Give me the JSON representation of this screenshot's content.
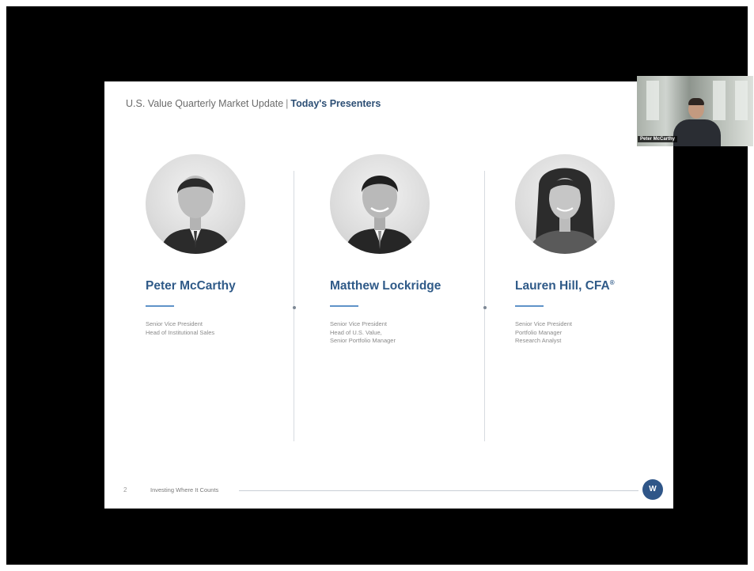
{
  "slide": {
    "title_prefix": "U.S. Value Quarterly Market Update",
    "title_separator": "|",
    "title_highlight": "Today's Presenters",
    "page_number": "2",
    "footer_text": "Investing Where It Counts",
    "logo_text": "W"
  },
  "presenters": [
    {
      "name": "Peter McCarthy",
      "titles": [
        "Senior Vice President",
        "Head of Institutional Sales"
      ]
    },
    {
      "name": "Matthew Lockridge",
      "titles": [
        "Senior Vice President",
        "Head of U.S. Value,",
        "Senior Portfolio Manager"
      ]
    },
    {
      "name": "Lauren Hill, CFA",
      "name_mark": "®",
      "titles": [
        "Senior Vice President",
        "Portfolio Manager",
        "Research Analyst"
      ]
    }
  ],
  "video_tile": {
    "participant_name": "Peter McCarthy"
  },
  "colors": {
    "accent_blue": "#2f5a88",
    "rule_blue": "#5f93c8",
    "frame_black": "#000000"
  }
}
